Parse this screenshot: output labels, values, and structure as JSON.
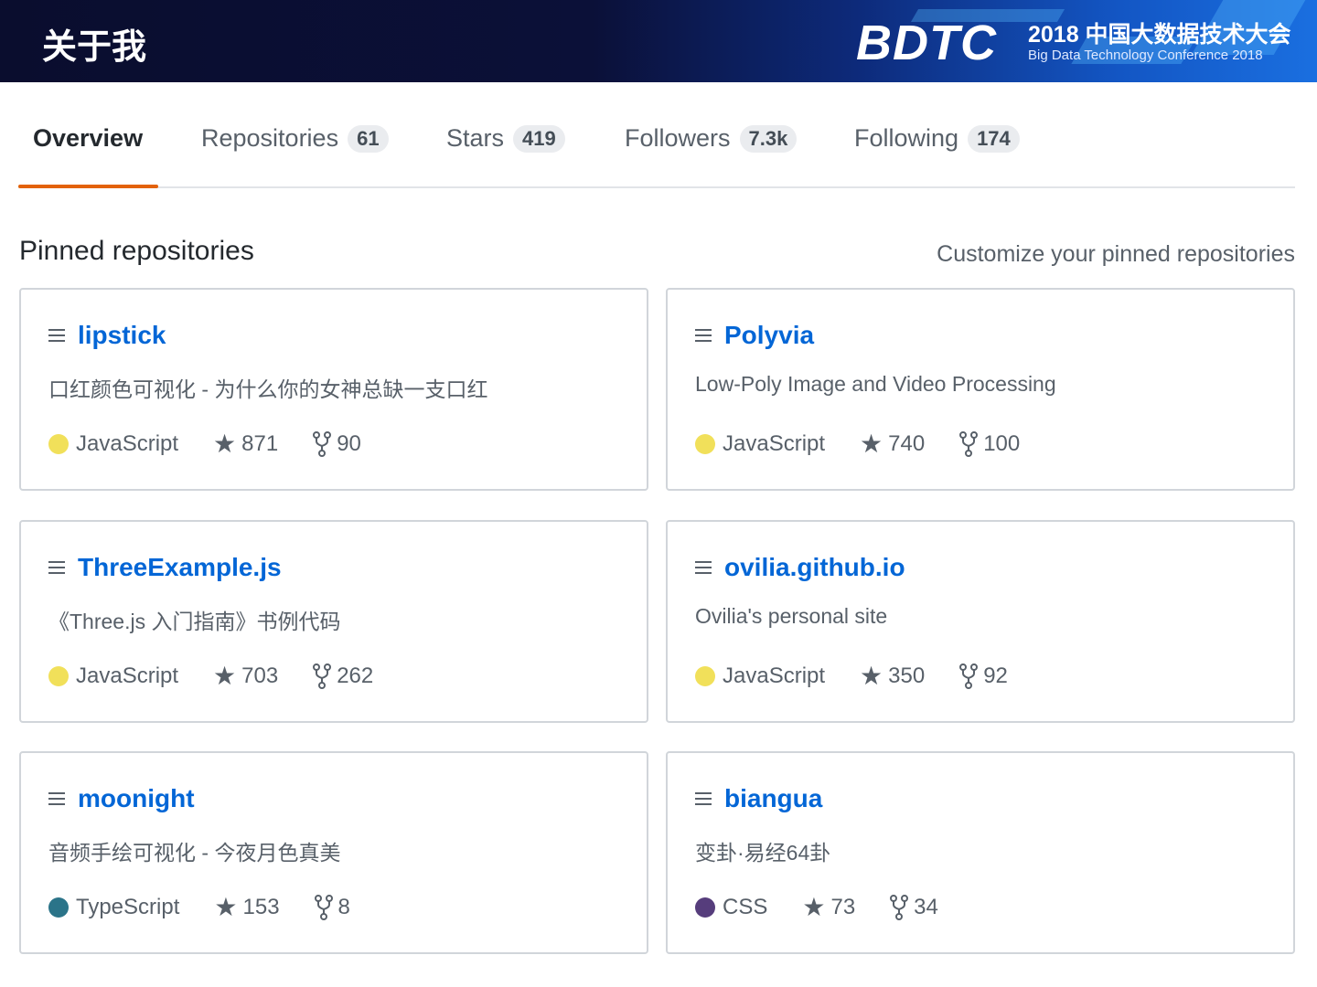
{
  "header": {
    "title": "关于我",
    "logo": "BDTC",
    "logo_cn": "2018 中国大数据技术大会",
    "logo_en": "Big Data Technology Conference 2018"
  },
  "tabs": [
    {
      "label": "Overview"
    },
    {
      "label": "Repositories",
      "count": "61"
    },
    {
      "label": "Stars",
      "count": "419"
    },
    {
      "label": "Followers",
      "count": "7.3k"
    },
    {
      "label": "Following",
      "count": "174"
    }
  ],
  "pinned": {
    "heading": "Pinned repositories",
    "customize": "Customize your pinned repositories",
    "repos": [
      {
        "name": "lipstick",
        "desc": "口红颜色可视化 - 为什么你的女神总缺一支口红",
        "lang": "JavaScript",
        "color": "#f1e05a",
        "stars": "871",
        "forks": "90"
      },
      {
        "name": "Polyvia",
        "desc": "Low-Poly Image and Video Processing",
        "lang": "JavaScript",
        "color": "#f1e05a",
        "stars": "740",
        "forks": "100"
      },
      {
        "name": "ThreeExample.js",
        "desc": "《Three.js 入门指南》书例代码",
        "lang": "JavaScript",
        "color": "#f1e05a",
        "stars": "703",
        "forks": "262"
      },
      {
        "name": "ovilia.github.io",
        "desc": "Ovilia's personal site",
        "lang": "JavaScript",
        "color": "#f1e05a",
        "stars": "350",
        "forks": "92"
      },
      {
        "name": "moonight",
        "desc": "音频手绘可视化 - 今夜月色真美",
        "lang": "TypeScript",
        "color": "#2b7489",
        "stars": "153",
        "forks": "8"
      },
      {
        "name": "biangua",
        "desc": "变卦·易经64卦",
        "lang": "CSS",
        "color": "#563d7c",
        "stars": "73",
        "forks": "34"
      }
    ]
  }
}
